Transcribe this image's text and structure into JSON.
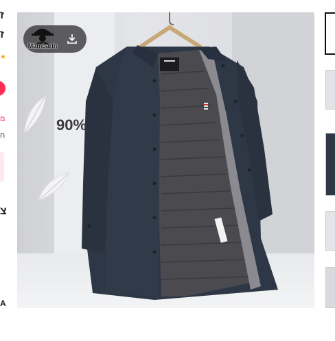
{
  "product_image": {
    "down_fill_percent": "90%",
    "watermark_name": "Mambarin",
    "coat_color": "#2e3745",
    "lining_color": "#4a4a4f"
  },
  "left_panel": {
    "title_char": "ז",
    "line2_char": "ז",
    "red_text": "ם",
    "small_text": "ח",
    "bottom_char1": "צ",
    "bottom_char2": "A"
  },
  "thumbnails": [
    "thumb-1",
    "thumb-2",
    "thumb-3",
    "thumb-4",
    "thumb-5"
  ]
}
